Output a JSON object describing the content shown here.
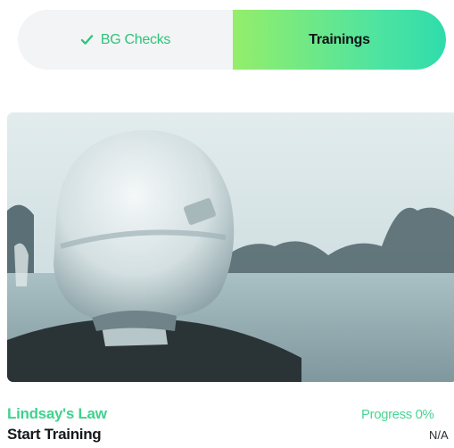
{
  "toggle": {
    "bg_checks_label": "BG Checks",
    "trainings_label": "Trainings",
    "active_tab": "Trainings",
    "accent_color": "#2ec37a"
  },
  "card": {
    "image_icon": "football-helmet-photo",
    "title": "Lindsay's Law",
    "action_label": "Start Training",
    "progress_label": "Progress 0%",
    "progress_value": "N/A"
  }
}
